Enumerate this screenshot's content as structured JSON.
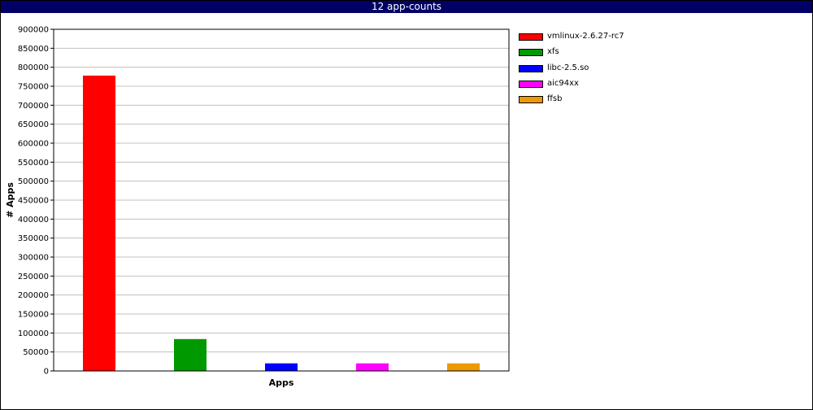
{
  "chart_data": {
    "type": "bar",
    "title": "12 app-counts",
    "xlabel": "Apps",
    "ylabel": "# Apps",
    "ylim": [
      0,
      900000
    ],
    "ytick_step": 50000,
    "grid": true,
    "legend_position": "right",
    "categories": [
      "vmlinux-2.6.27-rc7",
      "xfs",
      "libc-2.5.so",
      "aic94xx",
      "ffsb"
    ],
    "values": [
      778000,
      84000,
      20000,
      20000,
      20000
    ],
    "colors": [
      "#ff0000",
      "#009900",
      "#0000ff",
      "#ff00ff",
      "#ee9900"
    ]
  }
}
